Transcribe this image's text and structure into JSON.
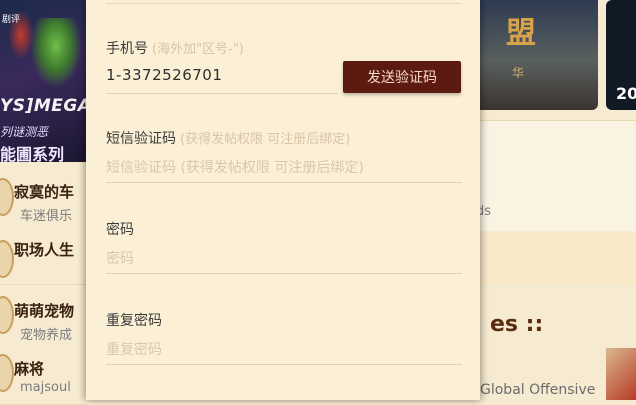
{
  "background": {
    "banner_left": {
      "tag": "剧评",
      "title": "YS]MEGA",
      "subtitle": "列谜测恶",
      "subtitle2": "能圃系列"
    },
    "banner_right": {
      "title": "盟",
      "sub": "华"
    },
    "banner_far": {
      "year": "20"
    },
    "ds_text": "ds",
    "games_title": "es ::",
    "global_offensive": "Global Offensive",
    "side_items": [
      {
        "name": "寂寞的车",
        "desc": "车迷俱乐"
      },
      {
        "name": "职场人生",
        "desc": ""
      },
      {
        "name": "萌萌宠物",
        "desc": "宠物养成"
      },
      {
        "name": "麻将",
        "desc": "majsoul"
      }
    ]
  },
  "form": {
    "phone": {
      "label": "手机号",
      "hint": "(海外加\"区号-\")",
      "value": "1-3372526701",
      "send_code_label": "发送验证码"
    },
    "sms": {
      "label": "短信验证码",
      "hint": "(获得发帖权限 可注册后绑定)",
      "placeholder": "短信验证码 (获得发帖权限 可注册后绑定)"
    },
    "password": {
      "label": "密码",
      "placeholder": "密码"
    },
    "confirm_password": {
      "label": "重复密码",
      "placeholder": "重复密码"
    }
  }
}
